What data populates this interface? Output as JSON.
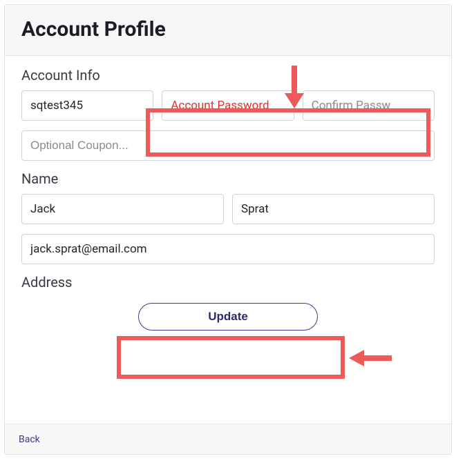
{
  "header": {
    "title": "Account Profile"
  },
  "sections": {
    "account": {
      "label": "Account Info",
      "username": {
        "value": "sqtest345"
      },
      "password": {
        "placeholder": "Account Password"
      },
      "confirm": {
        "placeholder": "Confirm Passw"
      },
      "coupon": {
        "placeholder": "Optional Coupon..."
      }
    },
    "name": {
      "label": "Name",
      "first": {
        "value": "Jack"
      },
      "last": {
        "value": "Sprat"
      },
      "email": {
        "value": "jack.sprat@email.com"
      }
    },
    "address": {
      "label": "Address"
    }
  },
  "actions": {
    "update": {
      "label": "Update"
    },
    "back": {
      "label": "Back"
    }
  },
  "annotations": {
    "highlight_color": "#ed5a5a",
    "targets": [
      "password-fields",
      "update-button"
    ]
  }
}
